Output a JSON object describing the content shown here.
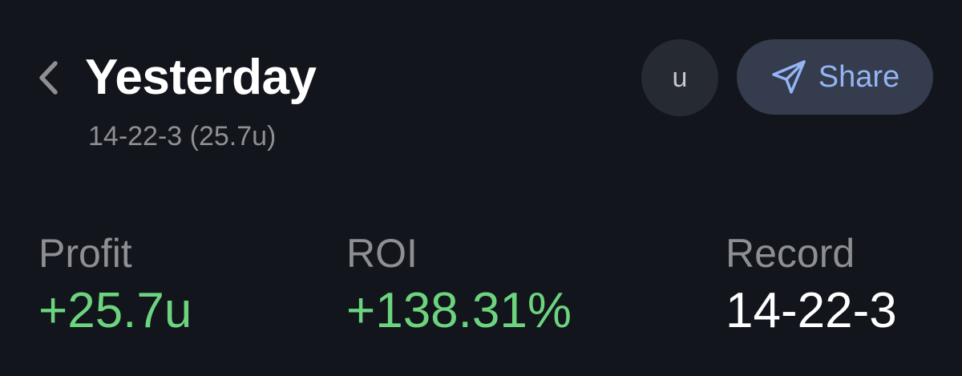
{
  "header": {
    "title": "Yesterday",
    "subtitle": "14-22-3 (25.7u)",
    "units_button_label": "u",
    "share_button_label": "Share"
  },
  "stats": [
    {
      "label": "Profit",
      "value": "+25.7u"
    },
    {
      "label": "ROI",
      "value": "+138.31%"
    },
    {
      "label": "Record",
      "value": "14-22-3"
    }
  ],
  "colors": {
    "background": "#12151c",
    "positive": "#6cd47e",
    "muted": "#8e8e93",
    "accent": "#94b4f3",
    "share_background": "#343c4d",
    "units_background": "#252a33"
  },
  "icons": {
    "back": "chevron-left-icon",
    "share": "paper-plane-icon"
  }
}
